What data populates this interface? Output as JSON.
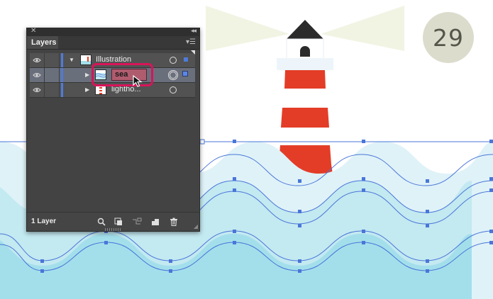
{
  "step": {
    "number": "29"
  },
  "colors": {
    "sky": "#ffffff",
    "wave_light": "#dff2f8",
    "wave_mid": "#c3e9f1",
    "wave_dark": "#a3dfeb",
    "guide": "#4a76d8",
    "lighthouse_red": "#e33d27",
    "lighthouse_white": "#ffffff",
    "lighthouse_roof": "#2b2b2b",
    "light_beam": "#f1f4e3",
    "highlight": "#d8145a",
    "badge": "#dcdccd"
  },
  "layers_panel": {
    "tab": "Layers",
    "status": "1 Layer",
    "rows": [
      {
        "name": "Illustration",
        "icon": "layer-thumbnail",
        "expanded": true
      },
      {
        "name": "sea",
        "icon": "sea-thumbnail",
        "renaming": true
      },
      {
        "name": "lightho...",
        "icon": "lighthouse-thumbnail"
      }
    ],
    "toolbar_icons": [
      "search-icon",
      "clipping-mask-icon",
      "new-sublayer-icon",
      "new-layer-icon",
      "trash-icon"
    ]
  }
}
